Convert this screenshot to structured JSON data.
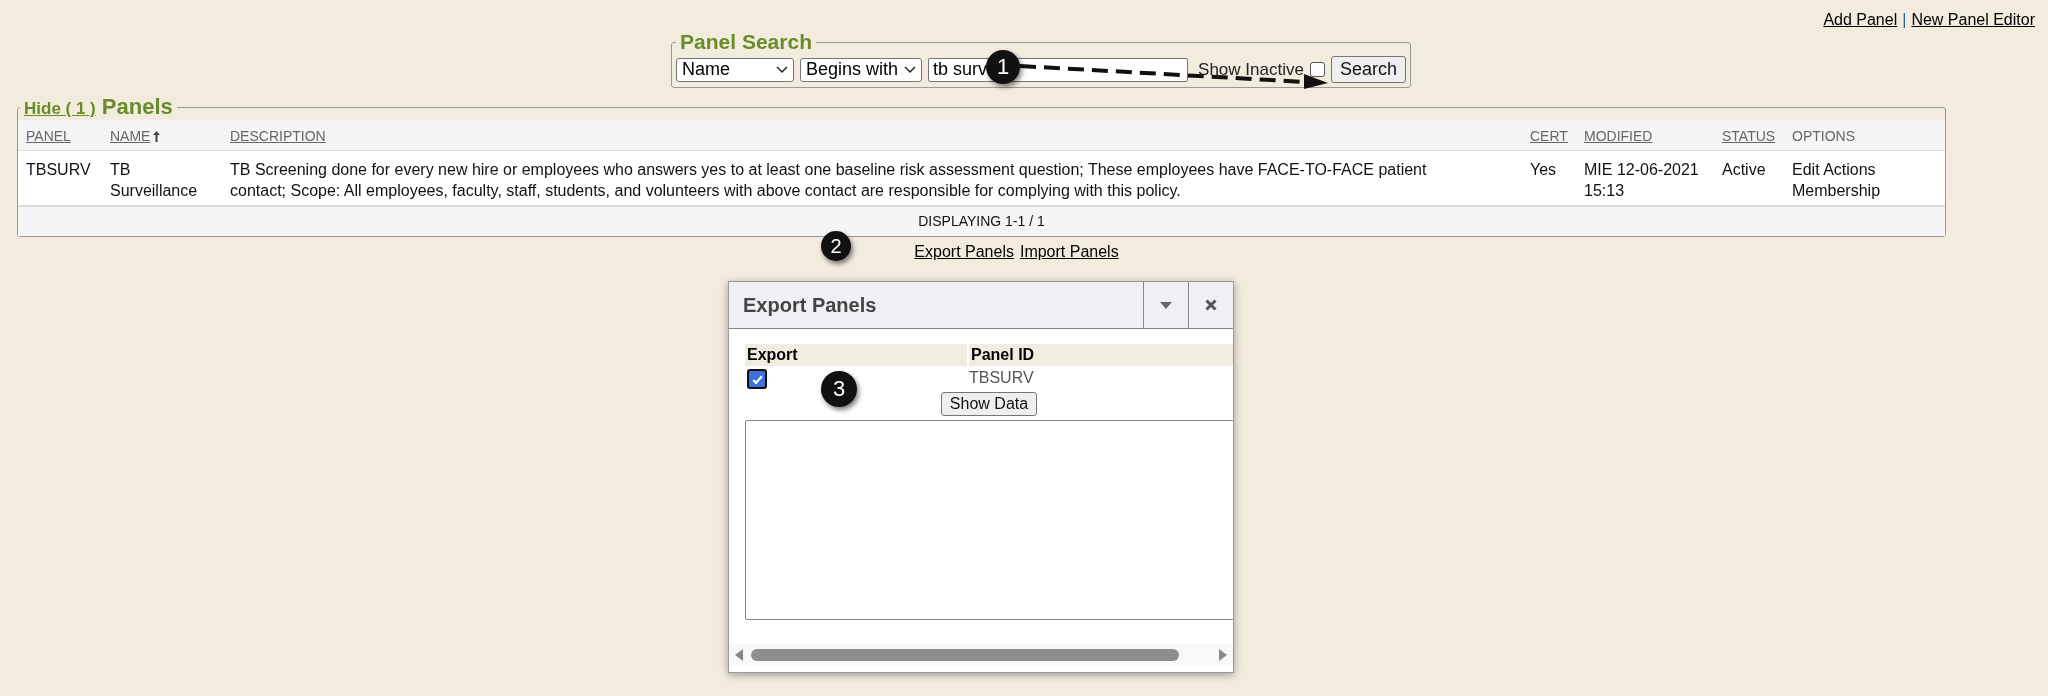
{
  "top_links": {
    "items": [
      "Add Panel",
      "New Panel Editor"
    ],
    "separator": "|"
  },
  "search": {
    "title": "Panel Search",
    "field": "Name",
    "operator": "Begins with",
    "query": "tb surv",
    "show_inactive": {
      "label": "Show Inactive",
      "checked": false
    },
    "button": "Search"
  },
  "panels": {
    "toggle": "Hide ( 1 )",
    "title": "Panels",
    "columns": [
      {
        "label": "PANEL",
        "sortable": true,
        "sorted": false
      },
      {
        "label": "NAME",
        "sortable": true,
        "sorted": true
      },
      {
        "label": "DESCRIPTION",
        "sortable": true,
        "sorted": false
      },
      {
        "label": "CERT",
        "sortable": true,
        "sorted": false
      },
      {
        "label": "MODIFIED",
        "sortable": true,
        "sorted": false
      },
      {
        "label": "STATUS",
        "sortable": true,
        "sorted": false
      },
      {
        "label": "OPTIONS",
        "sortable": false,
        "sorted": false
      }
    ],
    "rows": [
      {
        "panel": "TBSURV",
        "name": "TB Surveillance",
        "description": "TB Screening done for every new hire or employees who answers yes to at least one baseline risk assessment question; These employees have FACE-TO-FACE patient contact; Scope: All employees, faculty, staff, students, and volunteers with above contact are responsible for complying with this policy.",
        "cert": "Yes",
        "modified": "MIE 12-06-2021 15:13",
        "status": "Active",
        "options": [
          "Edit Actions",
          "Membership"
        ]
      }
    ],
    "footer": "DISPLAYING 1-1 / 1"
  },
  "links": [
    "Export Panels",
    "Import Panels"
  ],
  "dialog": {
    "title": "Export Panels",
    "columns": [
      "Export",
      "Panel ID"
    ],
    "rows": [
      {
        "checked": true,
        "panel_id": "TBSURV"
      }
    ],
    "button": "Show Data"
  },
  "annotations": [
    "1",
    "2",
    "3"
  ]
}
